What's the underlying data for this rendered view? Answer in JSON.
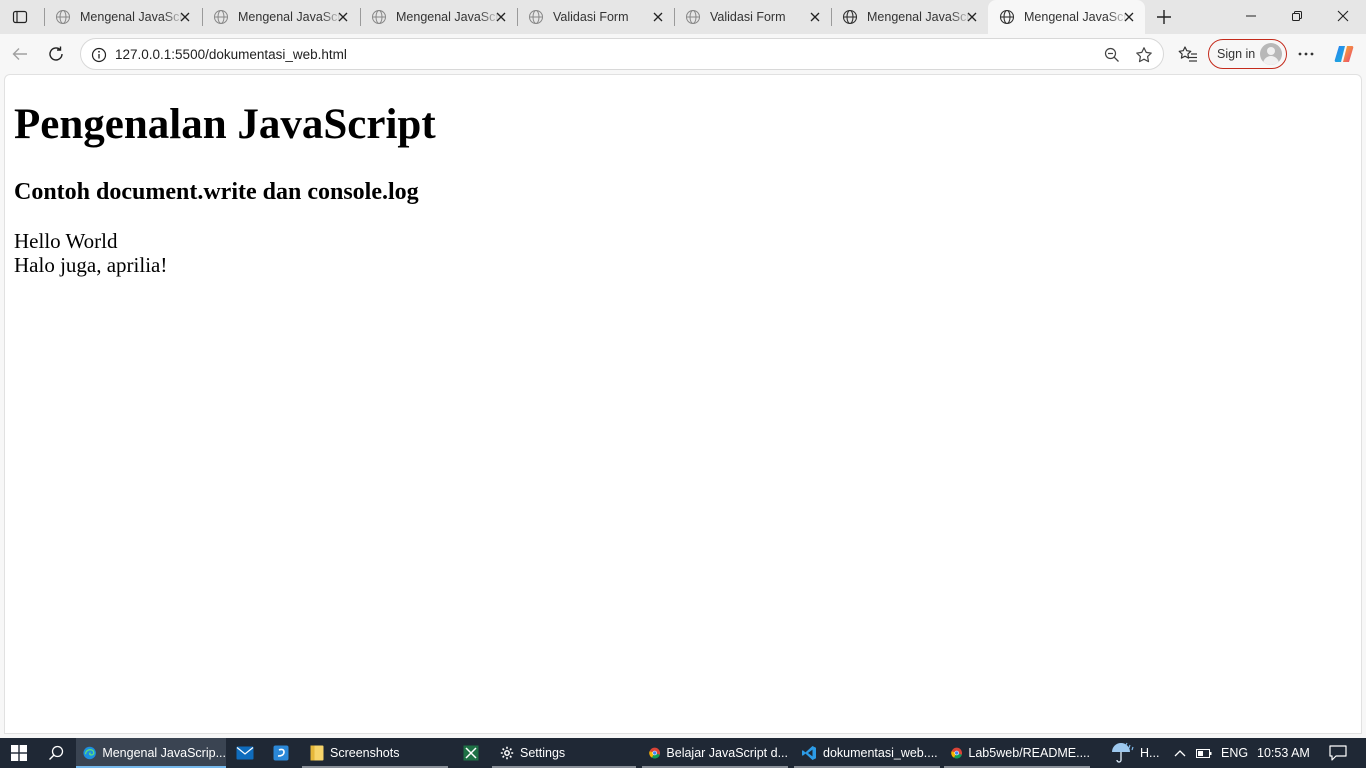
{
  "tabs": [
    {
      "title": "Mengenal JavaScript",
      "icon": "globe-icon"
    },
    {
      "title": "Mengenal JavaScript",
      "icon": "globe-icon"
    },
    {
      "title": "Mengenal JavaScript",
      "icon": "globe-icon"
    },
    {
      "title": "Validasi Form",
      "icon": "globe-icon"
    },
    {
      "title": "Validasi Form",
      "icon": "globe-icon"
    },
    {
      "title": "Mengenal JavaScript",
      "icon": "globe-icon"
    },
    {
      "title": "Mengenal JavaScript",
      "icon": "globe-icon",
      "active": true
    }
  ],
  "address": {
    "url": "127.0.0.1:5500/dokumentasi_web.html"
  },
  "toolbar": {
    "signin_label": "Sign in"
  },
  "page": {
    "heading": "Pengenalan JavaScript",
    "subheading": "Contoh document.write dan console.log",
    "output_line1": "Hello World",
    "output_line2": "Halo juga, aprilia!"
  },
  "taskbar": {
    "items": [
      {
        "label": "Mengenal JavaScrip...",
        "icon": "edge-icon",
        "active": true
      },
      {
        "label": "",
        "icon": "mail-icon"
      },
      {
        "label": "",
        "icon": "app-icon"
      },
      {
        "label": "Screenshots",
        "icon": "folder-icon"
      },
      {
        "label": "",
        "icon": "spreadsheet-icon"
      },
      {
        "label": "Settings",
        "icon": "gear-icon"
      },
      {
        "label": "Belajar JavaScript d...",
        "icon": "chrome-icon"
      },
      {
        "label": "dokumentasi_web....",
        "icon": "vscode-icon"
      },
      {
        "label": "Lab5web/README....",
        "icon": "chrome-icon"
      }
    ],
    "weather_label": "H...",
    "language": "ENG",
    "time": "10:53 AM"
  },
  "colors": {
    "accent": "#76b9ed",
    "signin_border": "#c42b1c",
    "taskbar_bg": "#1f2835"
  }
}
